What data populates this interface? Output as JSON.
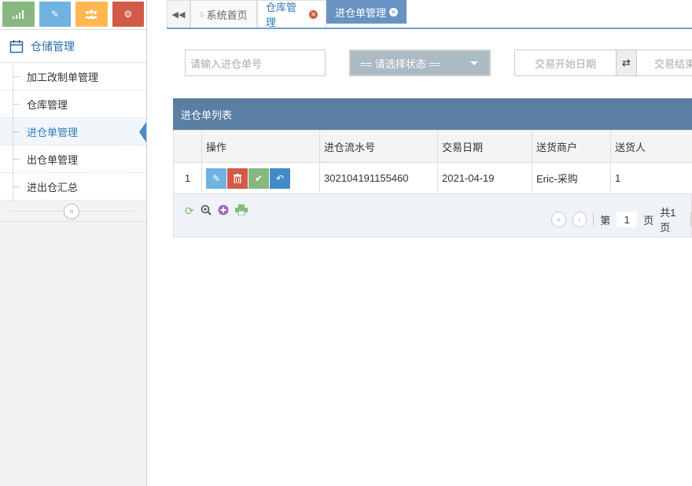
{
  "sidebar": {
    "shortcuts": [
      {
        "icon": "signal-icon",
        "color": "#87b87f"
      },
      {
        "icon": "pencil-icon",
        "color": "#6fb3e0"
      },
      {
        "icon": "users-icon",
        "color": "#ffb752"
      },
      {
        "icon": "cogs-icon",
        "color": "#d15b47"
      }
    ],
    "menu_title": "仓储管理",
    "items": [
      {
        "label": "加工改制单管理"
      },
      {
        "label": "仓库管理"
      },
      {
        "label": "进仓单管理"
      },
      {
        "label": "出仓单管理"
      },
      {
        "label": "进出仓汇总"
      }
    ]
  },
  "tabs": [
    {
      "label": "系统首页"
    },
    {
      "label": "仓库管理"
    },
    {
      "label": "进仓单管理"
    }
  ],
  "filters": {
    "order_placeholder": "请输入进仓单号",
    "status_select": "== 请选择状态 ==",
    "start_date_placeholder": "交易开始日期",
    "end_date_placeholder": "交易结束日期"
  },
  "grid": {
    "title": "进仓单列表",
    "columns": [
      "",
      "操作",
      "进仓流水号",
      "交易日期",
      "送货商户",
      "送货人"
    ],
    "rows": [
      {
        "num": "1",
        "serial": "302104191155460",
        "date": "2021-04-19",
        "merchant": "Eric-采购",
        "deliverer": "1"
      }
    ]
  },
  "pager": {
    "page_prefix": "第",
    "page_value": "1",
    "page_suffix": "页",
    "total": "共1页"
  },
  "colors": {
    "accent": "#6893c2",
    "grid_header": "#5b7ea3"
  }
}
